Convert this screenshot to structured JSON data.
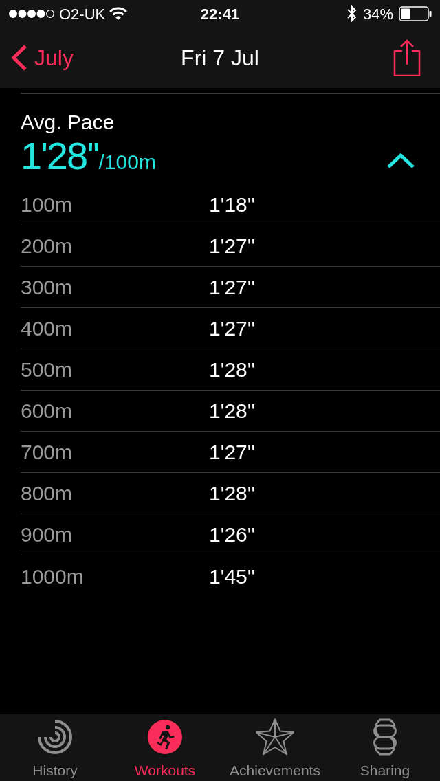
{
  "status_bar": {
    "carrier": "O2-UK",
    "time": "22:41",
    "battery": "34%"
  },
  "nav": {
    "back": "July",
    "title": "Fri 7 Jul"
  },
  "avg_pace": {
    "label": "Avg. Pace",
    "value": "1'28''",
    "unit": "/100m",
    "expanded": true
  },
  "splits": [
    {
      "distance": "100m",
      "pace": "1'18''"
    },
    {
      "distance": "200m",
      "pace": "1'27''"
    },
    {
      "distance": "300m",
      "pace": "1'27''"
    },
    {
      "distance": "400m",
      "pace": "1'27''"
    },
    {
      "distance": "500m",
      "pace": "1'28''"
    },
    {
      "distance": "600m",
      "pace": "1'28''"
    },
    {
      "distance": "700m",
      "pace": "1'27''"
    },
    {
      "distance": "800m",
      "pace": "1'28''"
    },
    {
      "distance": "900m",
      "pace": "1'26''"
    },
    {
      "distance": "1000m",
      "pace": "1'45''"
    }
  ],
  "tab_bar": [
    {
      "kind": "history",
      "label": "History",
      "selected": false
    },
    {
      "kind": "workouts",
      "label": "Workouts",
      "selected": true
    },
    {
      "kind": "achievements",
      "label": "Achievements",
      "selected": false
    },
    {
      "kind": "sharing",
      "label": "Sharing",
      "selected": false
    }
  ]
}
